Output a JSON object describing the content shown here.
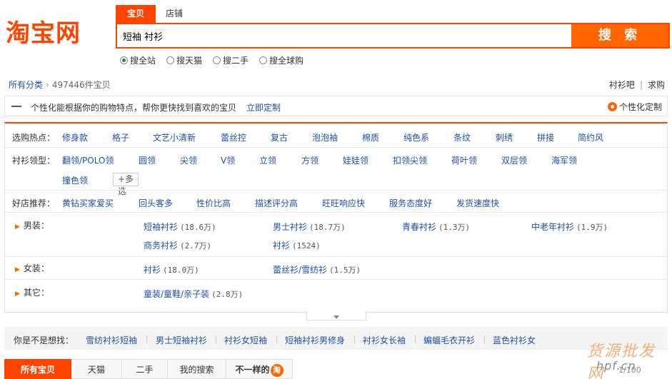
{
  "logo": "淘宝网",
  "search": {
    "tabs": [
      "宝贝",
      "店铺"
    ],
    "value": "短袖 衬衫",
    "button": "搜 索",
    "scopes": [
      {
        "label": "搜全站",
        "checked": true
      },
      {
        "label": "搜天猫",
        "checked": false
      },
      {
        "label": "搜二手",
        "checked": false
      },
      {
        "label": "搜全球购",
        "checked": false
      }
    ]
  },
  "breadcrumb": {
    "all": "所有分类",
    "count": "497446件宝贝"
  },
  "top_links": [
    "衬衫吧",
    "求购"
  ],
  "personal": {
    "text": "个性化能根据你的购物特点，帮你更快找到喜欢的宝贝",
    "link": "立即定制",
    "right": "个性化定制"
  },
  "filters": {
    "hot_label": "选购热点：",
    "hot": [
      "修身款",
      "格子",
      "文艺小清新",
      "蕾丝控",
      "复古",
      "泡泡袖",
      "棉质",
      "纯色系",
      "条纹",
      "刺绣",
      "拼接",
      "简约风"
    ],
    "collar_label": "衬衫领型：",
    "collar": [
      "翻领/POLO领",
      "圆领",
      "尖领",
      "V领",
      "立领",
      "方领",
      "娃娃领",
      "扣领尖领",
      "荷叶领",
      "双层领",
      "海军领",
      "撞色领"
    ],
    "more": "+多选",
    "shop_label": "好店推荐：",
    "shop": [
      "黄钻买家爱买",
      "回头客多",
      "性价比高",
      "描述评分高",
      "旺旺响应快",
      "服务态度好",
      "发货速度快"
    ]
  },
  "categories": [
    {
      "label": "男装：",
      "items": [
        {
          "name": "短袖衬衫",
          "count": "(18.6万)"
        },
        {
          "name": "男士衬衫",
          "count": "(18.7万)"
        },
        {
          "name": "青春衬衫",
          "count": "(1.3万)"
        },
        {
          "name": "中老年衬衫",
          "count": "(1.9万)"
        },
        {
          "name": "商务衬衫",
          "count": "(2.7万)"
        },
        {
          "name": "衬衫",
          "count": "(1524)"
        }
      ]
    },
    {
      "label": "女装：",
      "items": [
        {
          "name": "衬衫",
          "count": "(18.0万)"
        },
        {
          "name": "蕾丝衫/雪纺衫",
          "count": "(1.5万)"
        }
      ]
    },
    {
      "label": "其它：",
      "items": [
        {
          "name": "童装/童鞋/亲子装",
          "count": "(2.8万)"
        }
      ]
    }
  ],
  "suggest": {
    "title": "你是不是想找：",
    "items": [
      "雪纺衬衫短袖",
      "男士短袖衬衫",
      "衬衫女短袖",
      "短袖衬衫男修身",
      "衬衫女长袖",
      "蝙蝠毛衣开衫",
      "蓝色衬衫女"
    ]
  },
  "bottom_tabs": [
    "所有宝贝",
    "天猫",
    "二手",
    "我的搜索",
    "不一样的",
    "淘"
  ],
  "watermark": "货源批发网",
  "watermark_sub": "hpf.cn",
  "pager": "1/100"
}
